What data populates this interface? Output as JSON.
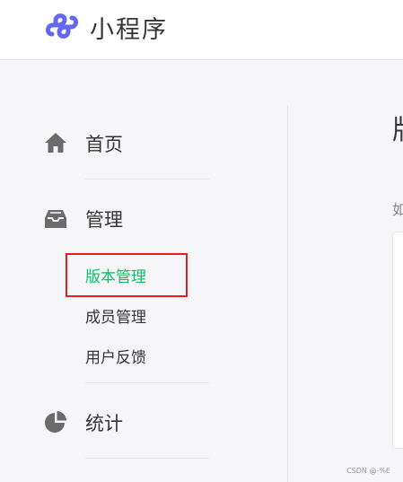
{
  "app": {
    "title": "小程序",
    "brand_color": "#6467f0"
  },
  "sidebar": {
    "accent_color": "#07c160",
    "items": [
      {
        "icon": "home-icon",
        "label": "首页"
      },
      {
        "icon": "inbox-icon",
        "label": "管理",
        "children": [
          {
            "label": "版本管理",
            "active": true
          },
          {
            "label": "成员管理",
            "active": false
          },
          {
            "label": "用户反馈",
            "active": false
          }
        ]
      },
      {
        "icon": "pie-chart-icon",
        "label": "统计"
      }
    ]
  },
  "main": {
    "heading": "版",
    "subtext": "如"
  },
  "annotation": {
    "highlight_color": "#e02020"
  },
  "watermark": "CSDN @-%E"
}
